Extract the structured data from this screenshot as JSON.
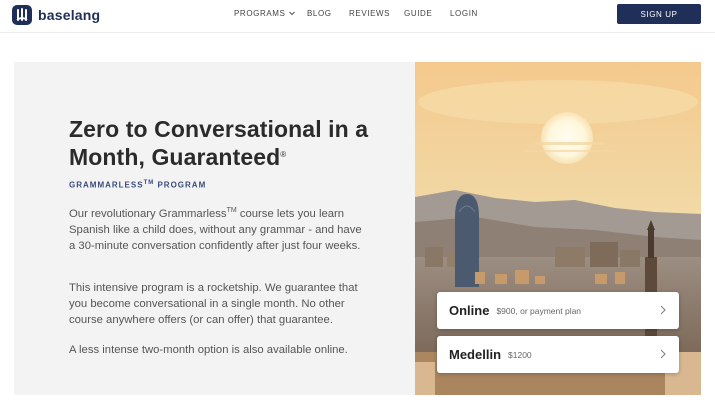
{
  "nav": {
    "logo_text": "baselang",
    "links": [
      {
        "label": "PROGRAMS"
      },
      {
        "label": "BLOG"
      },
      {
        "label": "REVIEWS"
      },
      {
        "label": "GUIDE"
      },
      {
        "label": "LOGIN"
      }
    ],
    "signup_label": "SIGN UP"
  },
  "hero": {
    "title": "Zero to Conversational in a Month, Guaranteed",
    "title_mark": "®",
    "subtitle": "GRAMMARLESS",
    "subtitle_tm": "TM",
    "subtitle_suffix": " PROGRAM",
    "p1_a": "Our revolutionary Grammarless",
    "p1_tm": "TM",
    "p1_b": " course lets you learn Spanish like a child does, without any grammar - and have a 30-minute conversation confidently after just four weeks.",
    "p2": "This intensive program is a rocketship. We guarantee that you become conversational in a single month. No other course anywhere offers (or can offer) that guarantee.",
    "p3": "A less intense two-month option is also available online."
  },
  "options": [
    {
      "name": "Online",
      "price": "$900, or payment plan"
    },
    {
      "name": "Medellin",
      "price": "$1200"
    }
  ],
  "colors": {
    "brand": "#1f2f57",
    "panel_bg": "#f3f3f4",
    "subtitle": "#3a4a7a"
  }
}
